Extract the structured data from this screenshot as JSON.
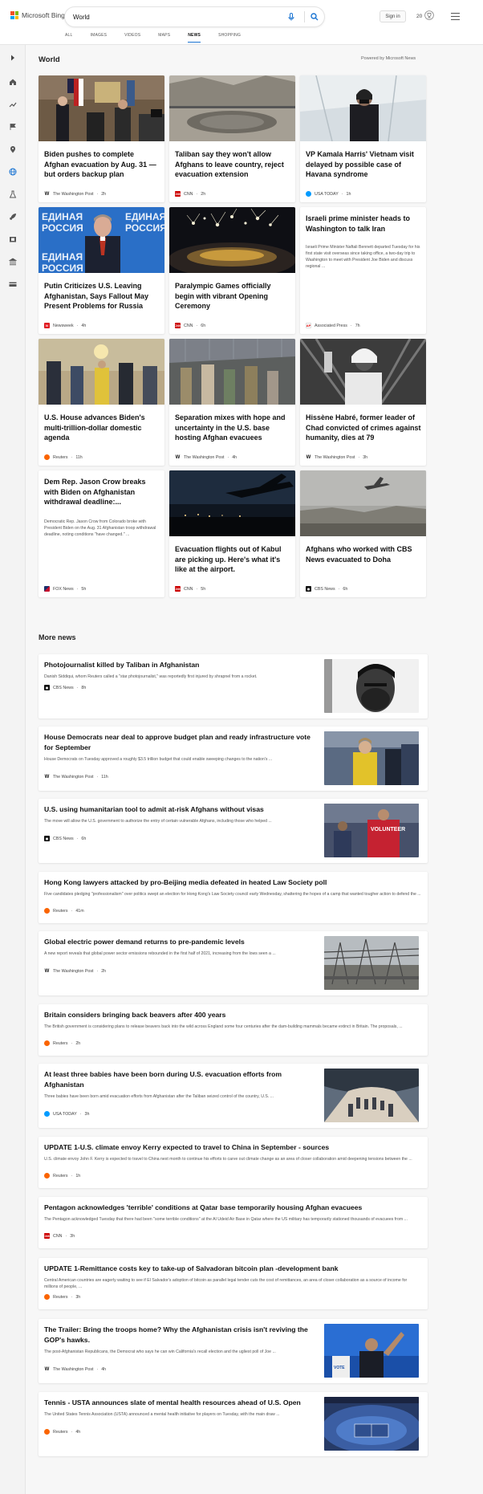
{
  "header": {
    "logo_text": "Microsoft Bing",
    "search_value": "World",
    "signin_label": "Sign in",
    "rewards_count": "20",
    "scopes": [
      "ALL",
      "IMAGES",
      "VIDEOS",
      "MAPS",
      "NEWS",
      "SHOPPING"
    ],
    "active_scope": "NEWS"
  },
  "colors": {
    "accent": "#1a74d2",
    "cnn": "#cc0000",
    "usatoday": "#009bff",
    "reuters": "#fa6400"
  },
  "rail_icons": [
    "expand-icon",
    "home-icon",
    "trending-icon",
    "flag-icon",
    "location-icon",
    "globe-icon",
    "science-icon",
    "rocket-icon",
    "film-icon",
    "bank-icon",
    "money-icon"
  ],
  "world": {
    "title": "World",
    "powered_by": "Powered by Microsoft News",
    "cards": [
      {
        "title": "Biden pushes to complete Afghan evacuation by Aug. 31 — but orders backup plan",
        "provider": "The Washington Post",
        "time": "2h",
        "snippet": ""
      },
      {
        "title": "Taliban say they won't allow Afghans to leave country, reject evacuation extension",
        "provider": "CNN",
        "time": "2h",
        "snippet": ""
      },
      {
        "title": "VP Kamala Harris' Vietnam visit delayed by possible case of Havana syndrome",
        "provider": "USA TODAY",
        "time": "1h",
        "snippet": ""
      },
      {
        "title": "Putin Criticizes U.S. Leaving Afghanistan, Says Fallout May Present Problems for Russia",
        "provider": "Newsweek",
        "time": "4h",
        "snippet": ""
      },
      {
        "title": "Paralympic Games officially begin with vibrant Opening Ceremony",
        "provider": "CNN",
        "time": "6h",
        "snippet": ""
      },
      {
        "title": "Israeli prime minister heads to Washington to talk Iran",
        "provider": "Associated Press",
        "time": "7h",
        "snippet": "Israeli Prime Minister Naftali Bennett departed Tuesday for his first state visit overseas since taking office, a two-day trip to Washington to meet with President Joe Biden and discuss regional ..."
      },
      {
        "title": "U.S. House advances Biden's multi-trillion-dollar domestic agenda",
        "provider": "Reuters",
        "time": "11h",
        "snippet": ""
      },
      {
        "title": "Separation mixes with hope and uncertainty in the U.S. base hosting Afghan evacuees",
        "provider": "The Washington Post",
        "time": "4h",
        "snippet": ""
      },
      {
        "title": "Hissène Habré, former leader of Chad convicted of crimes against humanity, dies at 79",
        "provider": "The Washington Post",
        "time": "3h",
        "snippet": ""
      },
      {
        "title": "Dem Rep. Jason Crow breaks with Biden on Afghanistan withdrawal deadline:...",
        "provider": "FOX News",
        "time": "5h",
        "snippet": "Democratic Rep. Jason Crow from Colorado broke with President Biden on the Aug. 31 Afghanistan troop withdrawal deadline, noting conditions \"have changed.\" ..."
      },
      {
        "title": "Evacuation flights out of Kabul are picking up. Here's what it's like at the airport.",
        "provider": "CNN",
        "time": "5h",
        "snippet": ""
      },
      {
        "title": "Afghans who worked with CBS News evacuated to Doha",
        "provider": "CBS News",
        "time": "6h",
        "snippet": ""
      }
    ]
  },
  "more_news": {
    "title": "More news",
    "items": [
      {
        "title": "Photojournalist killed by Taliban in Afghanistan",
        "snippet": "Danish Siddiqui, whom Reuters called a \"star photojournalist,\" was reportedly first injured by shrapnel from a rocket.",
        "provider": "CBS News",
        "time": "8h"
      },
      {
        "title": "House Democrats near deal to approve budget plan and ready infrastructure vote for September",
        "snippet": "House Democrats on Tuesday approved a roughly $3.5 trillion budget that could enable sweeping changes to the nation's ...",
        "provider": "The Washington Post",
        "time": "11h"
      },
      {
        "title": "U.S. using humanitarian tool to admit at-risk Afghans without visas",
        "snippet": "The move will allow the U.S. government to authorize the entry of certain vulnerable Afghans, including those who helped ...",
        "provider": "CBS News",
        "time": "6h"
      },
      {
        "title": "Hong Kong lawyers attacked by pro-Beijing media defeated in heated Law Society poll",
        "snippet": "Five candidates pledging \"professionalism\" over politics swept an election for Hong Kong's Law Society council early Wednesday, shattering the hopes of a camp that wanted tougher action to defend the ...",
        "provider": "Reuters",
        "time": "41m"
      },
      {
        "title": "Global electric power demand returns to pre-pandemic levels",
        "snippet": "A new report reveals that global power sector emissions rebounded in the first half of 2021, increasing from the lows seen a ...",
        "provider": "The Washington Post",
        "time": "2h"
      },
      {
        "title": "Britain considers bringing back beavers after 400 years",
        "snippet": "The British government is considering plans to release beavers back into the wild across England some four centuries after the dam-building mammals became extinct in Britain. The proposals, ...",
        "provider": "Reuters",
        "time": "2h"
      },
      {
        "title": "At least three babies have been born during U.S. evacuation efforts from Afghanistan",
        "snippet": "Three babies have been born amid evacuation efforts from Afghanistan after the Taliban seized control of the country, U.S. ...",
        "provider": "USA TODAY",
        "time": "3h"
      },
      {
        "title": "UPDATE 1-U.S. climate envoy Kerry expected to travel to China in September - sources",
        "snippet": "U.S. climate envoy John F. Kerry is expected to travel to China next month to continue his efforts to carve out climate change as an area of closer collaboration amid deepening tensions between the ...",
        "provider": "Reuters",
        "time": "1h"
      },
      {
        "title": "Pentagon acknowledges 'terrible' conditions at Qatar base temporarily housing Afghan evacuees",
        "snippet": "The Pentagon acknowledged Tuesday that there had been \"some terrible conditions\" at the Al Udeid Air Base in Qatar where the US military has temporarily stationed thousands of evacuees from ...",
        "provider": "CNN",
        "time": "3h"
      },
      {
        "title": "UPDATE 1-Remittance costs key to take-up of Salvadoran bitcoin plan -development bank",
        "snippet": "Central American countries are eagerly waiting to see if El Salvador's adoption of bitcoin as parallel legal tender cuts the cost of remittances, an area of closer collaboration as a source of income for millions of people, ...",
        "provider": "Reuters",
        "time": "3h"
      },
      {
        "title": "The Trailer: Bring the troops home? Why the Afghanistan crisis isn't reviving the GOP's hawks.",
        "snippet": "The post-Afghanistan Republicans, the Democrat who says he can win California's recall election and the ugliest poll of Joe ...",
        "provider": "The Washington Post",
        "time": "4h"
      },
      {
        "title": "Tennis - USTA announces slate of mental health resources ahead of U.S. Open",
        "snippet": "The United States Tennis Association (USTA) announced a mental health initiative for players on Tuesday, with the main draw ...",
        "provider": "Reuters",
        "time": "4h"
      }
    ]
  }
}
